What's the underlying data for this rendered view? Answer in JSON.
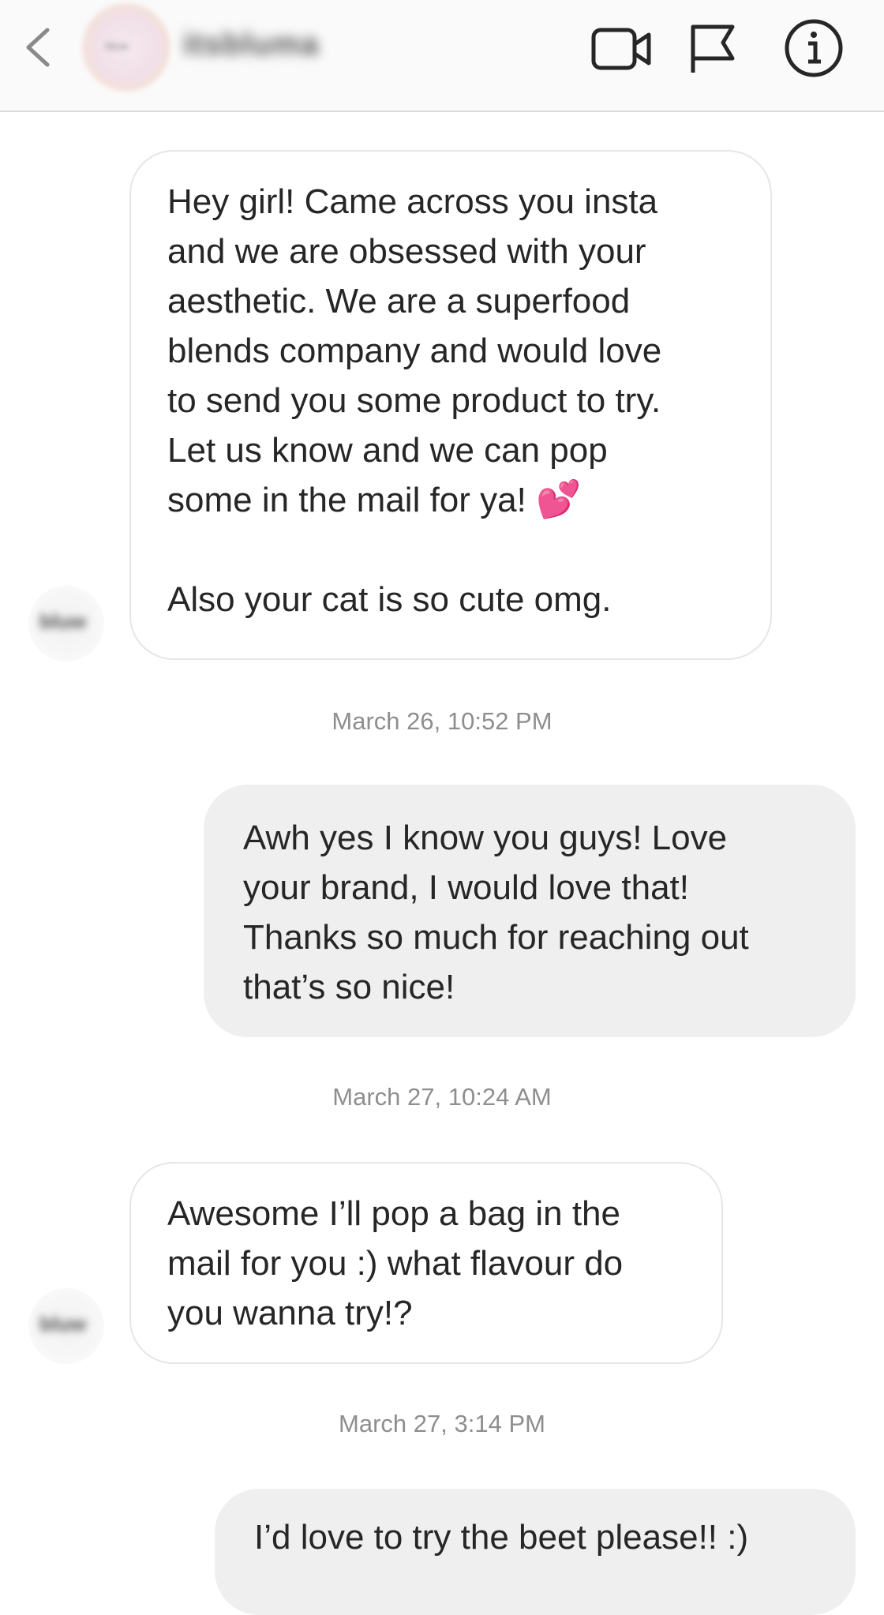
{
  "header": {
    "username": "itsbluma",
    "avatar_text": "bluw",
    "icons": {
      "back": "chevron-left-icon",
      "video": "video-camera-icon",
      "flag": "flag-icon",
      "info": "info-icon"
    }
  },
  "messages": [
    {
      "direction": "received",
      "text_main": "Hey girl! Came across you insta\nand we are obsessed with your\naesthetic. We are a superfood\nblends company and would love\nto send you some product to try.\nLet us know and we can pop\nsome in the mail for ya! ",
      "emoji": "💕",
      "text_after": "\n\nAlso your cat is so cute omg.",
      "sender_avatar_text": "bluw"
    },
    {
      "direction": "sent",
      "timestamp": "March 26, 10:52 PM",
      "text": "Awh yes I know you guys! Love\nyour brand, I would love that!\nThanks so much for reaching out\nthat’s so nice!"
    },
    {
      "direction": "received",
      "timestamp": "March 27, 10:24 AM",
      "text": "Awesome I’ll pop a bag in the\nmail for you :) what flavour do\nyou wanna try!?",
      "sender_avatar_text": "bluw"
    },
    {
      "direction": "sent",
      "timestamp": "March 27, 3:14 PM",
      "text": "I’d love to try the beet please!! :)"
    }
  ],
  "colors": {
    "header_bg": "#fafafa",
    "sent_bubble": "#efefef",
    "received_border": "#e6e6e6",
    "timestamp_text": "#8e8e8e",
    "message_text": "#262626"
  }
}
